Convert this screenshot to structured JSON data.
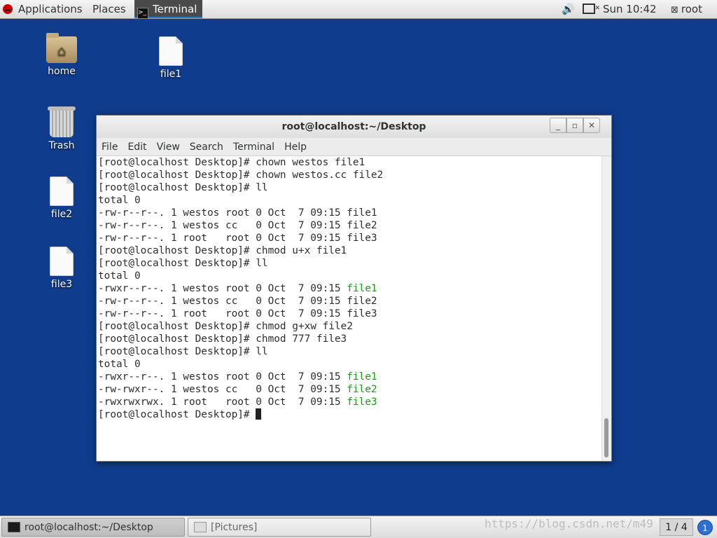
{
  "top_panel": {
    "applications": "Applications",
    "places": "Places",
    "active_app": "Terminal",
    "clock": "Sun 10:42",
    "user": "root"
  },
  "desktop_icons": [
    {
      "label": "home",
      "icon": "home-folder-icon"
    },
    {
      "label": "file1",
      "icon": "document-icon"
    },
    {
      "label": "Trash",
      "icon": "trash-icon"
    },
    {
      "label": "file2",
      "icon": "document-icon"
    },
    {
      "label": "file3",
      "icon": "document-icon"
    }
  ],
  "window": {
    "title": "root@localhost:~/Desktop",
    "menu": [
      "File",
      "Edit",
      "View",
      "Search",
      "Terminal",
      "Help"
    ]
  },
  "terminal_lines": [
    [
      {
        "t": "[root@localhost Desktop]# chown westos file1"
      }
    ],
    [
      {
        "t": "[root@localhost Desktop]# chown westos.cc file2"
      }
    ],
    [
      {
        "t": "[root@localhost Desktop]# ll"
      }
    ],
    [
      {
        "t": "total 0"
      }
    ],
    [
      {
        "t": "-rw-r--r--. 1 westos root 0 Oct  7 09:15 file1"
      }
    ],
    [
      {
        "t": "-rw-r--r--. 1 westos cc   0 Oct  7 09:15 file2"
      }
    ],
    [
      {
        "t": "-rw-r--r--. 1 root   root 0 Oct  7 09:15 file3"
      }
    ],
    [
      {
        "t": "[root@localhost Desktop]# chmod u+x file1"
      }
    ],
    [
      {
        "t": "[root@localhost Desktop]# ll"
      }
    ],
    [
      {
        "t": "total 0"
      }
    ],
    [
      {
        "t": "-rwxr--r--. 1 westos root 0 Oct  7 09:15 "
      },
      {
        "t": "file1",
        "c": "g"
      }
    ],
    [
      {
        "t": "-rw-r--r--. 1 westos cc   0 Oct  7 09:15 file2"
      }
    ],
    [
      {
        "t": "-rw-r--r--. 1 root   root 0 Oct  7 09:15 file3"
      }
    ],
    [
      {
        "t": "[root@localhost Desktop]# chmod g+xw file2"
      }
    ],
    [
      {
        "t": "[root@localhost Desktop]# chmod 777 file3"
      }
    ],
    [
      {
        "t": "[root@localhost Desktop]# ll"
      }
    ],
    [
      {
        "t": "total 0"
      }
    ],
    [
      {
        "t": "-rwxr--r--. 1 westos root 0 Oct  7 09:15 "
      },
      {
        "t": "file1",
        "c": "g"
      }
    ],
    [
      {
        "t": "-rw-rwxr--. 1 westos cc   0 Oct  7 09:15 "
      },
      {
        "t": "file2",
        "c": "g"
      }
    ],
    [
      {
        "t": "-rwxrwxrwx. 1 root   root 0 Oct  7 09:15 "
      },
      {
        "t": "file3",
        "c": "g"
      }
    ],
    [
      {
        "t": "[root@localhost Desktop]# "
      },
      {
        "cursor": true
      }
    ]
  ],
  "taskbar": {
    "tasks": [
      {
        "label": "root@localhost:~/Desktop",
        "active": true
      },
      {
        "label": "[Pictures]",
        "active": false
      }
    ],
    "workspace": "1 / 4",
    "notifications": "1",
    "watermark": "https://blog.csdn.net/m49"
  },
  "colors": {
    "desktop_bg": "#0f3c8c",
    "executable_file": "#1e9a1e"
  }
}
